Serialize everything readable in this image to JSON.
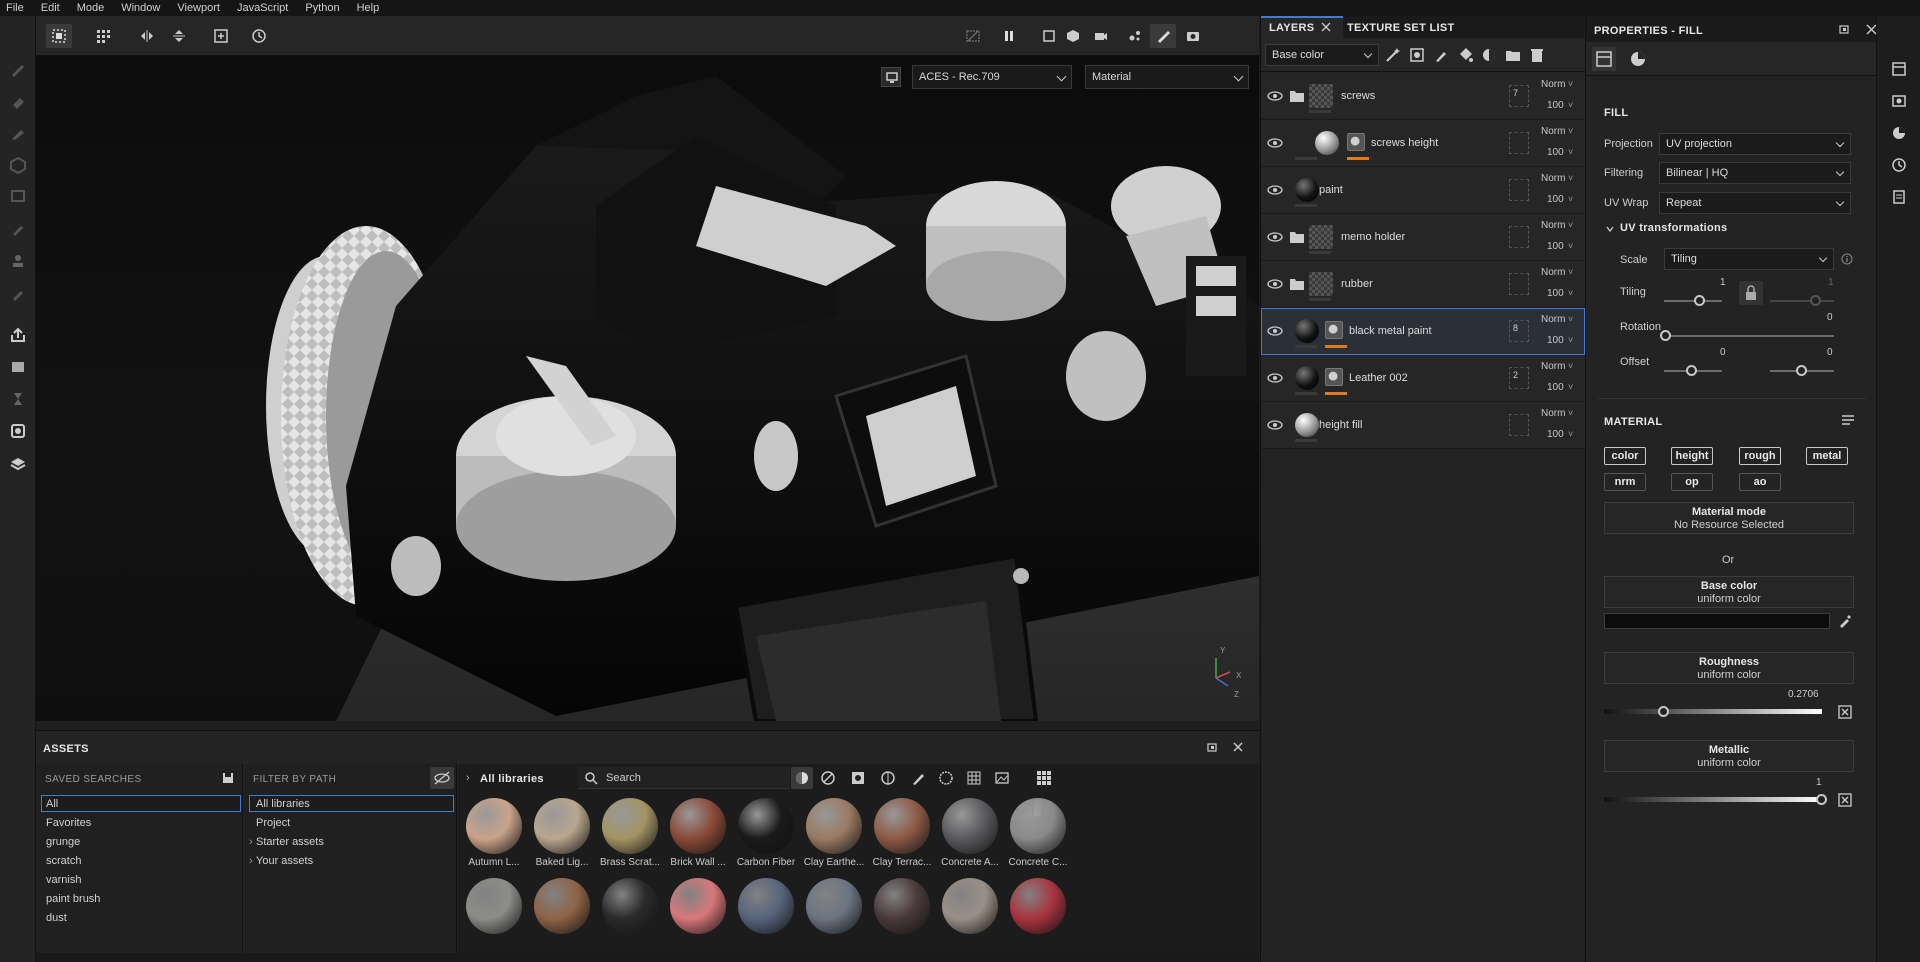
{
  "menu": [
    "File",
    "Edit",
    "Mode",
    "Window",
    "Viewport",
    "JavaScript",
    "Python",
    "Help"
  ],
  "viewport": {
    "colorspace": "ACES - Rec.709",
    "display_mode": "Material",
    "axis": {
      "y": "Y",
      "x": "X",
      "z": "Z"
    }
  },
  "assets": {
    "title": "ASSETS",
    "saved_searches_label": "SAVED SEARCHES",
    "filter_by_path_label": "FILTER BY PATH",
    "libraries_breadcrumb": "All libraries",
    "search_placeholder": "Search",
    "saved_searches": [
      "All",
      "Favorites",
      "grunge",
      "scratch",
      "varnish",
      "paint brush",
      "dust"
    ],
    "paths": [
      "All libraries",
      "Project",
      "Starter assets",
      "Your assets"
    ],
    "materials_row1": [
      {
        "label": "Autumn L...",
        "color": "#c9a38a"
      },
      {
        "label": "Baked Lig...",
        "color": "#b9a68d"
      },
      {
        "label": "Brass Scrat...",
        "color": "#a39463"
      },
      {
        "label": "Brick Wall ...",
        "color": "#8a4a38"
      },
      {
        "label": "Carbon Fiber",
        "color": "#1a1a1a"
      },
      {
        "label": "Clay Earthe...",
        "color": "#9a7a62"
      },
      {
        "label": "Clay Terrac...",
        "color": "#8d5a46"
      },
      {
        "label": "Concrete A...",
        "color": "#5a5a5e"
      },
      {
        "label": "Concrete C...",
        "color": "#8a8a8a"
      }
    ],
    "materials_row2_colors": [
      "#8c8c88",
      "#8e6446",
      "#2a2a2a",
      "#d7777a",
      "#56647a",
      "#6c7482",
      "#4a3a3a",
      "#9a8f86",
      "#a8343f"
    ]
  },
  "layers": {
    "tabs": [
      "LAYERS",
      "TEXTURE SET LIST"
    ],
    "channel": "Base color",
    "items": [
      {
        "name": "screws",
        "count": "7",
        "blend": "Norm",
        "opacity": "100",
        "type": "folder"
      },
      {
        "name": "screws height",
        "count": "",
        "blend": "Norm",
        "opacity": "100",
        "type": "fill-mask"
      },
      {
        "name": "paint",
        "count": "",
        "blend": "Norm",
        "opacity": "100",
        "type": "fill"
      },
      {
        "name": "memo holder",
        "count": "",
        "blend": "Norm",
        "opacity": "100",
        "type": "folder"
      },
      {
        "name": "rubber",
        "count": "",
        "blend": "Norm",
        "opacity": "100",
        "type": "folder"
      },
      {
        "name": "black metal paint",
        "count": "8",
        "blend": "Norm",
        "opacity": "100",
        "type": "fill-mask"
      },
      {
        "name": "Leather 002",
        "count": "2",
        "blend": "Norm",
        "opacity": "100",
        "type": "fill-mask"
      },
      {
        "name": "height fill",
        "count": "",
        "blend": "Norm",
        "opacity": "100",
        "type": "fill"
      }
    ]
  },
  "properties": {
    "title": "PROPERTIES - FILL",
    "fill_section": "FILL",
    "projection_label": "Projection",
    "projection": "UV projection",
    "filtering_label": "Filtering",
    "filtering": "Bilinear | HQ",
    "uvwrap_label": "UV Wrap",
    "uvwrap": "Repeat",
    "uv_transform": "UV transformations",
    "scale_label": "Scale",
    "scale": "Tiling",
    "tiling_label": "Tiling",
    "tiling_u": "1",
    "tiling_v": "1",
    "rotation_label": "Rotation",
    "rotation": "0",
    "offset_label": "Offset",
    "offset_u": "0",
    "offset_v": "0",
    "material_section": "MATERIAL",
    "channels": [
      "color",
      "height",
      "rough",
      "metal",
      "nrm",
      "op",
      "ao"
    ],
    "material_mode_label": "Material mode",
    "material_mode_value": "No Resource Selected",
    "or": "Or",
    "base_color_label": "Base color",
    "base_color_mode": "uniform color",
    "roughness_label": "Roughness",
    "roughness_mode": "uniform color",
    "roughness_value": "0.2706",
    "metallic_label": "Metallic",
    "metallic_mode": "uniform color",
    "metallic_value": "1"
  }
}
